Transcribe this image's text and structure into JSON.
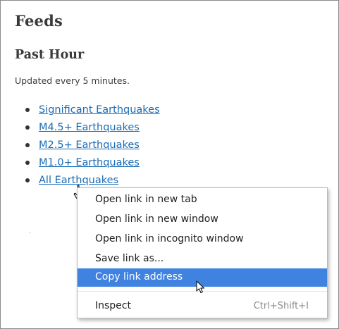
{
  "page": {
    "title": "Feeds",
    "section_title": "Past Hour",
    "update_note": "Updated every 5 minutes."
  },
  "feeds": [
    {
      "label": "Significant Earthquakes"
    },
    {
      "label": "M4.5+ Earthquakes"
    },
    {
      "label": "M2.5+ Earthquakes"
    },
    {
      "label": "M1.0+ Earthquakes"
    },
    {
      "label": "All Earthquakes"
    }
  ],
  "context_menu": {
    "items": [
      {
        "label": "Open link in new tab"
      },
      {
        "label": "Open link in new window"
      },
      {
        "label": "Open link in incognito window"
      },
      {
        "label": "Save link as..."
      },
      {
        "label": "Copy link address",
        "highlighted": true
      },
      {
        "label": "Inspect",
        "shortcut": "Ctrl+Shift+I"
      }
    ]
  },
  "colors": {
    "link": "#1a6bb5",
    "heading": "#3a3a3a",
    "menu_highlight": "#3f82e0"
  },
  "icons": {
    "hand_cursor": "hand-pointer-icon",
    "arrow_cursor": "arrow-pointer-icon"
  }
}
